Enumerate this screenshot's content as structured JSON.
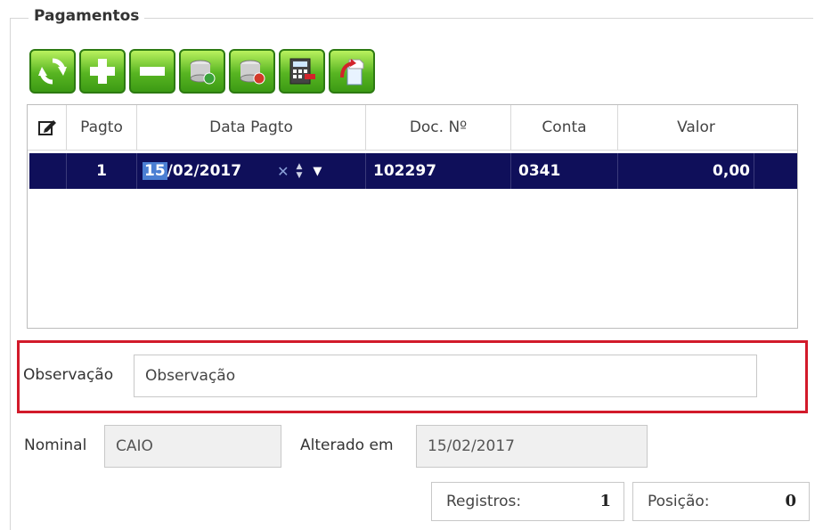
{
  "group_title": "Pagamentos",
  "toolbar": {
    "buttons": [
      {
        "icon": "refresh-icon"
      },
      {
        "icon": "plus-icon"
      },
      {
        "icon": "minus-icon"
      },
      {
        "icon": "database-confirm-icon"
      },
      {
        "icon": "database-cancel-icon"
      },
      {
        "icon": "calculator-icon"
      },
      {
        "icon": "export-icon"
      }
    ]
  },
  "grid": {
    "columns": [
      "Pagto",
      "Data Pagto",
      "Doc. Nº",
      "Conta",
      "Valor"
    ],
    "rows": [
      {
        "pagto": "1",
        "date_day": "15",
        "date_rest": "/02/2017",
        "doc": "102297",
        "conta": "0341",
        "valor": "0,00"
      }
    ]
  },
  "observacao": {
    "label": "Observação",
    "value": "Observação"
  },
  "nominal": {
    "label": "Nominal",
    "value": "CAIO"
  },
  "alterado": {
    "label": "Alterado em",
    "value": "15/02/2017"
  },
  "status": {
    "registros_label": "Registros:",
    "registros_value": "1",
    "posicao_label": "Posição:",
    "posicao_value": "0"
  },
  "colors": {
    "selection": "#0f0f5a",
    "highlight_border": "#d21a2a",
    "button_green": "#58b522"
  }
}
